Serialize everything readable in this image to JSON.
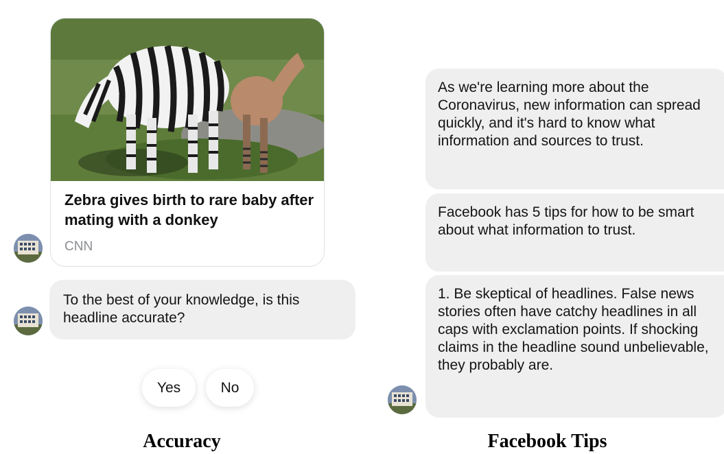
{
  "accuracy_panel": {
    "link_card": {
      "title": "Zebra gives birth to rare baby after mating with a donkey",
      "source": "CNN",
      "image_icon": "zebra-donkey-photo"
    },
    "question": "To the best of your knowledge, is this headline accurate?",
    "quick_replies": [
      "Yes",
      "No"
    ],
    "caption": "Accuracy"
  },
  "tips_panel": {
    "messages": [
      "As we're learning more about the Coronavirus, new information can spread quickly, and it's hard to know what information and sources to trust.",
      "Facebook has 5 tips for how to be smart about what information to trust.",
      "1. Be skeptical of headlines. False news stories often have catchy headlines in all caps with exclamation points. If shocking claims in the headline sound unbelievable, they probably are."
    ],
    "caption": "Facebook Tips"
  },
  "colors": {
    "bubble_bg": "#efefef",
    "card_border": "#dcdfe4",
    "source_text": "#8a8d91"
  }
}
